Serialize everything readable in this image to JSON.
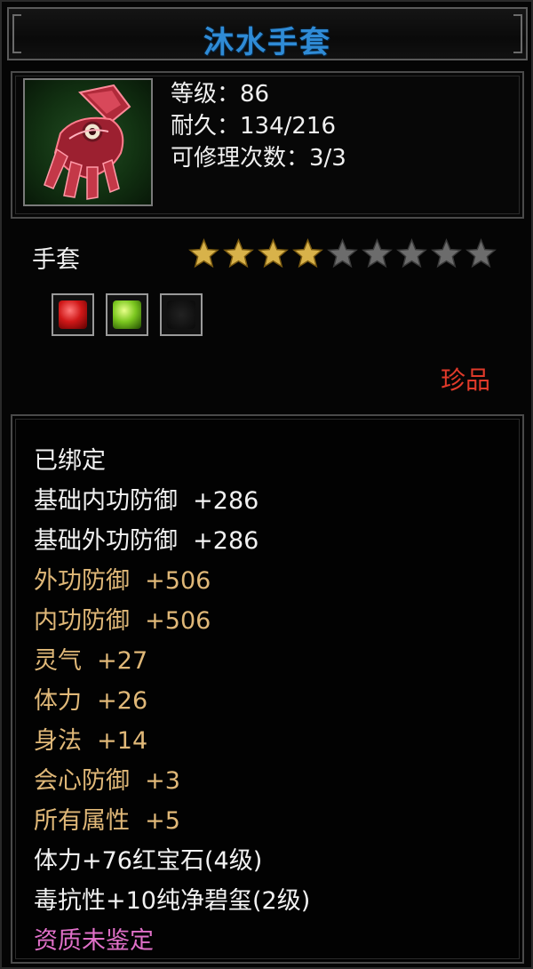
{
  "item": {
    "name": "沐水手套",
    "level_label": "等级：86",
    "durability_label": "耐久：134/216",
    "repair_label": "可修理次数：3/3",
    "type": "手套",
    "rarity": "珍品"
  },
  "stars": {
    "total": 9,
    "filled": 4,
    "filled_color": "#d8b24a",
    "empty_color": "#6c6c6c"
  },
  "sockets": [
    {
      "gem": "red-gem-icon",
      "color": "#d01818"
    },
    {
      "gem": "green-gem-icon",
      "color": "#7cc820"
    },
    {
      "gem": "empty-socket-icon",
      "color": "#111111"
    }
  ],
  "colors": {
    "title": "#2f8bd6",
    "rarity": "#e03a2a",
    "white_attr": "#f2f2f2",
    "gold_attr": "#e0b878",
    "pink_attr": "#e070c8"
  },
  "attributes": {
    "bound": "已绑定",
    "base_inner_def": "基础内功防御  +286",
    "base_outer_def": "基础外功防御  +286",
    "outer_def": "外功防御  +506",
    "inner_def": "内功防御  +506",
    "spirit": "灵气  +27",
    "stamina": "体力  +26",
    "agility": "身法  +14",
    "crit_def": "会心防御  +3",
    "all_attr": "所有属性  +5",
    "gem1": "体力+76红宝石(4级)",
    "gem2": "毒抗性+10纯净碧玺(2级)",
    "quality": "资质未鉴定"
  }
}
